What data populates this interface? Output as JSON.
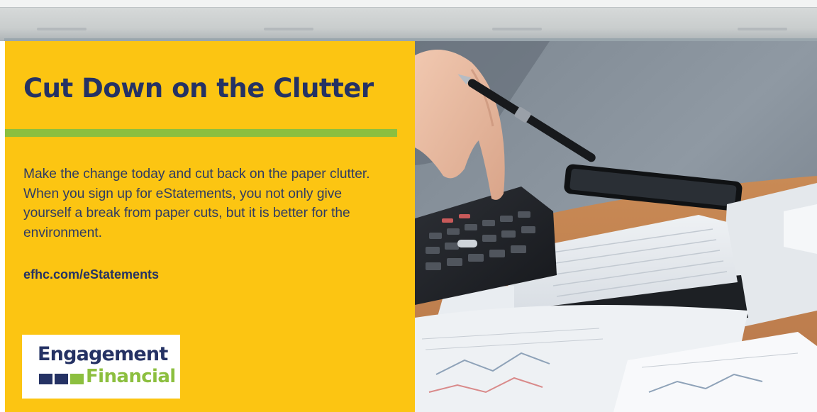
{
  "ad": {
    "headline": "Cut Down on the Clutter",
    "body": "Make the change today and cut back on the paper clutter. When you sign up for eStatements, you not only give yourself a break from paper cuts, but it is better for the environment.",
    "link": "efhc.com/eStatements"
  },
  "logo": {
    "line1": "Engagement",
    "line2": "Financial",
    "squares": [
      "#253264",
      "#253264",
      "#8cbf3f"
    ]
  },
  "colors": {
    "panel": "#fcc512",
    "navy": "#253264",
    "green": "#8cbf3f"
  },
  "photo": {
    "icon": "calculator-paperwork-photo"
  }
}
